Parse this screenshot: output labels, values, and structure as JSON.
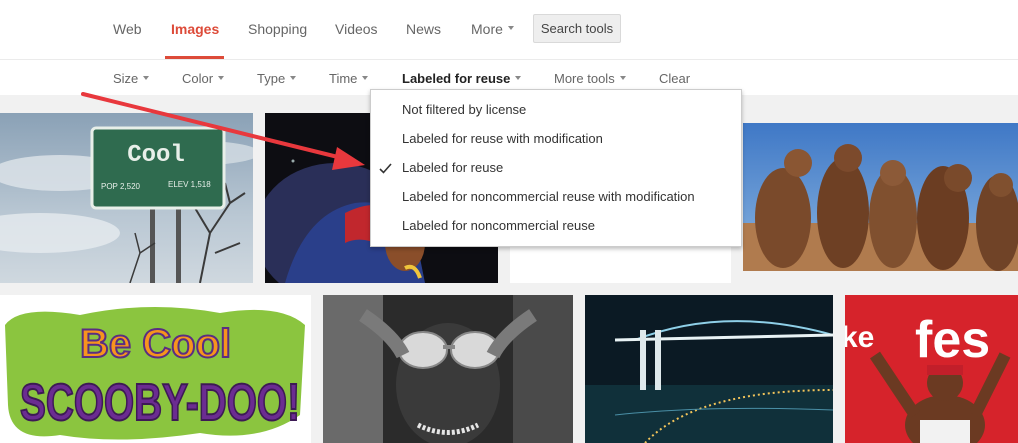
{
  "nav": {
    "tabs": [
      "Web",
      "Images",
      "Shopping",
      "Videos",
      "News",
      "More"
    ],
    "search_tools": "Search tools"
  },
  "toolbar": {
    "size": "Size",
    "color": "Color",
    "type": "Type",
    "time": "Time",
    "usage": "Labeled for reuse",
    "more_tools": "More tools",
    "clear": "Clear"
  },
  "dropdown": {
    "options": [
      "Not filtered by license",
      "Labeled for reuse with modification",
      "Labeled for reuse",
      "Labeled for noncommercial reuse with modification",
      "Labeled for noncommercial reuse"
    ],
    "selected": "Labeled for reuse"
  },
  "images": {
    "cool_sign": {
      "title": "Cool",
      "pop": "POP 2,520",
      "elev": "ELEV 1,518"
    },
    "scooby": {
      "line1": "Be Cool",
      "line2": "SCOOBY-DOO!"
    },
    "festival_text": "fes",
    "festival_text2": "ke"
  },
  "colors": {
    "accent": "#dd4b39",
    "annotation_arrow": "#e8383d"
  }
}
